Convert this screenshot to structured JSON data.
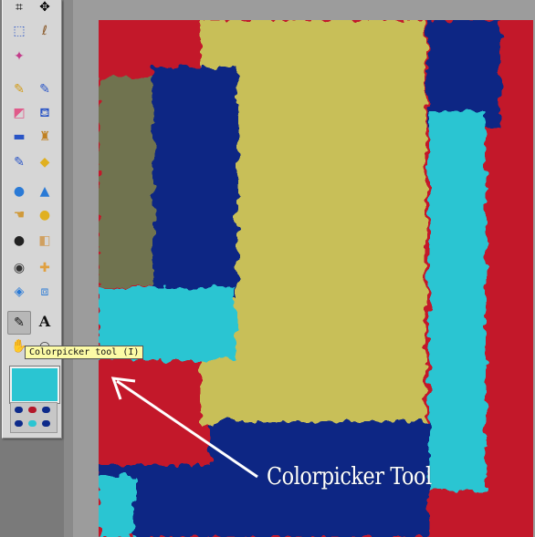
{
  "tooltip": {
    "text": "Colorpicker tool (I)"
  },
  "callout": {
    "text": "Colorpicker Tool"
  },
  "colors": {
    "foreground": "#2ac5d2",
    "palette": [
      "#0d2a8a",
      "#b3182a",
      "#0d2a8a",
      "#2ac5d2",
      "#0d2a8a",
      "#0d2a8a"
    ],
    "canvas_red": "#c3182a",
    "canvas_yellow": "#c8bf58",
    "canvas_blue": "#0d2584",
    "canvas_cyan": "#2ac5d2",
    "canvas_olive": "#6f7350"
  },
  "tools": [
    {
      "name": "crop-icon",
      "glyph": "⌗"
    },
    {
      "name": "move-icon",
      "glyph": "✥"
    },
    {
      "name": "marquee-icon",
      "glyph": "⬚"
    },
    {
      "name": "lasso-icon",
      "glyph": "ℓ"
    },
    {
      "name": "magic-wand-icon",
      "glyph": "✦"
    },
    {
      "name": "pencil-icon",
      "glyph": "✎"
    },
    {
      "name": "brush-icon",
      "glyph": "🖌"
    },
    {
      "name": "eraser-icon",
      "glyph": "◩"
    },
    {
      "name": "paint-bucket-icon",
      "glyph": "⛾"
    },
    {
      "name": "gradient-icon",
      "glyph": "▭"
    },
    {
      "name": "stamp-icon",
      "glyph": "♜"
    },
    {
      "name": "replace-color-icon",
      "glyph": "✎"
    },
    {
      "name": "shapes-icon",
      "glyph": "◆"
    },
    {
      "name": "blur-icon",
      "glyph": "💧"
    },
    {
      "name": "sharpen-icon",
      "glyph": "▲"
    },
    {
      "name": "smudge-icon",
      "glyph": "☚"
    },
    {
      "name": "sponge-icon",
      "glyph": "●"
    },
    {
      "name": "zoom-icon",
      "glyph": "🔍"
    },
    {
      "name": "dodge-icon",
      "glyph": "▼"
    },
    {
      "name": "red-eye-icon",
      "glyph": "👁"
    },
    {
      "name": "spot-heal-icon",
      "glyph": "✚"
    },
    {
      "name": "bloat-icon",
      "glyph": "◈"
    },
    {
      "name": "pinch-icon",
      "glyph": "⧈"
    },
    {
      "name": "colorpicker-icon",
      "glyph": "🖉"
    },
    {
      "name": "type-icon",
      "glyph": "A"
    },
    {
      "name": "hand-icon",
      "glyph": "✋"
    },
    {
      "name": "zoom-tool-icon",
      "glyph": "○"
    }
  ]
}
